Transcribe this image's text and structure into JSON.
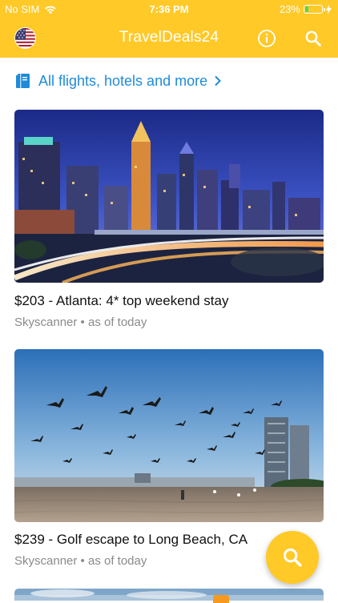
{
  "statusbar": {
    "carrier": "No SIM",
    "time": "7:36 PM",
    "battery": "23%",
    "battery_level": 0.23
  },
  "appbar": {
    "title": "TravelDeals24",
    "flag_icon": "us-flag-icon",
    "info_icon": "info-icon",
    "search_icon": "search-icon"
  },
  "all_link": {
    "label": "All flights, hotels and more",
    "icon": "book-icon",
    "chevron": "chevron-right-icon",
    "color": "#1F8BD8"
  },
  "deals": [
    {
      "title": "$203 - Atlanta: 4* top weekend stay",
      "source": "Skyscanner",
      "sep": "•",
      "when": "as of today"
    },
    {
      "title": "$239 - Golf escape to Long Beach, CA",
      "source": "Skyscanner",
      "sep": "•",
      "when": "as of today"
    }
  ],
  "colors": {
    "brand": "#FFC928",
    "accent_orange": "#F59A1E"
  }
}
